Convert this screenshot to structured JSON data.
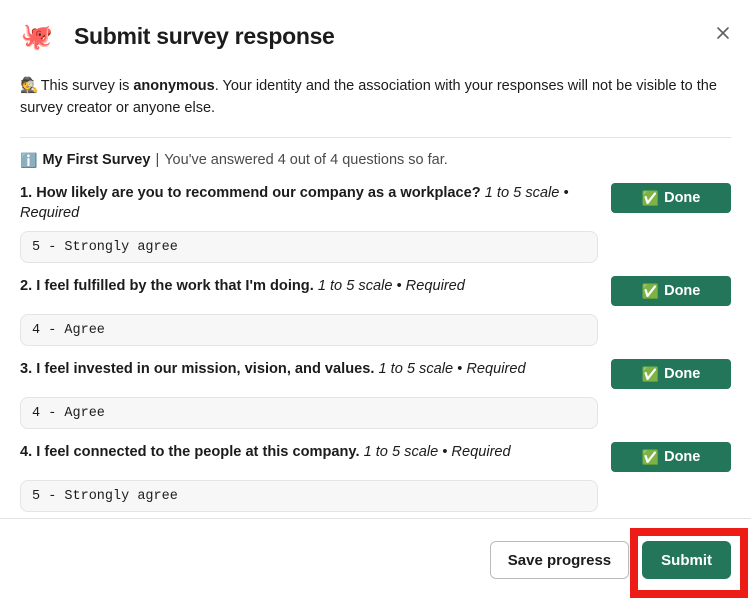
{
  "header": {
    "emoji": "🐙",
    "emoji_name": "octopus-emoji",
    "title": "Submit survey response",
    "close_label": "✕"
  },
  "notice": {
    "emoji": "🕵️",
    "emoji_name": "detective-emoji",
    "lead": "This survey is ",
    "bold": "anonymous",
    "rest": ". Your identity and the association with your responses will not be visible to the survey creator or anyone else."
  },
  "survey_meta": {
    "info_emoji": "ℹ️",
    "survey_name": "My First Survey",
    "separator": " | ",
    "progress_text": "You've answered 4 out of 4 questions so far."
  },
  "done_button": {
    "emoji": "✅",
    "label": "Done"
  },
  "questions": [
    {
      "number": "1.",
      "text": "How likely are you to recommend our company as a workplace?",
      "scale": "1 to 5 scale • Required",
      "answer": "5 - Strongly agree",
      "status": "Done"
    },
    {
      "number": "2.",
      "text": "I feel fulfilled by the work that I'm doing.",
      "scale": "1 to 5 scale • Required",
      "answer": "4 - Agree",
      "status": "Done"
    },
    {
      "number": "3.",
      "text": "I feel invested in our mission, vision, and values.",
      "scale": "1 to 5 scale • Required",
      "answer": "4 - Agree",
      "status": "Done"
    },
    {
      "number": "4.",
      "text": "I feel connected to the people at this company.",
      "scale": "1 to 5 scale • Required",
      "answer": "5 - Strongly agree",
      "status": "Done"
    }
  ],
  "footer": {
    "save_label": "Save progress",
    "submit_label": "Submit"
  },
  "colors": {
    "primary_green": "#23765a",
    "annotation_red": "#ee1c16",
    "field_bg": "#f7f7f7",
    "divider": "#e2e2e2"
  }
}
